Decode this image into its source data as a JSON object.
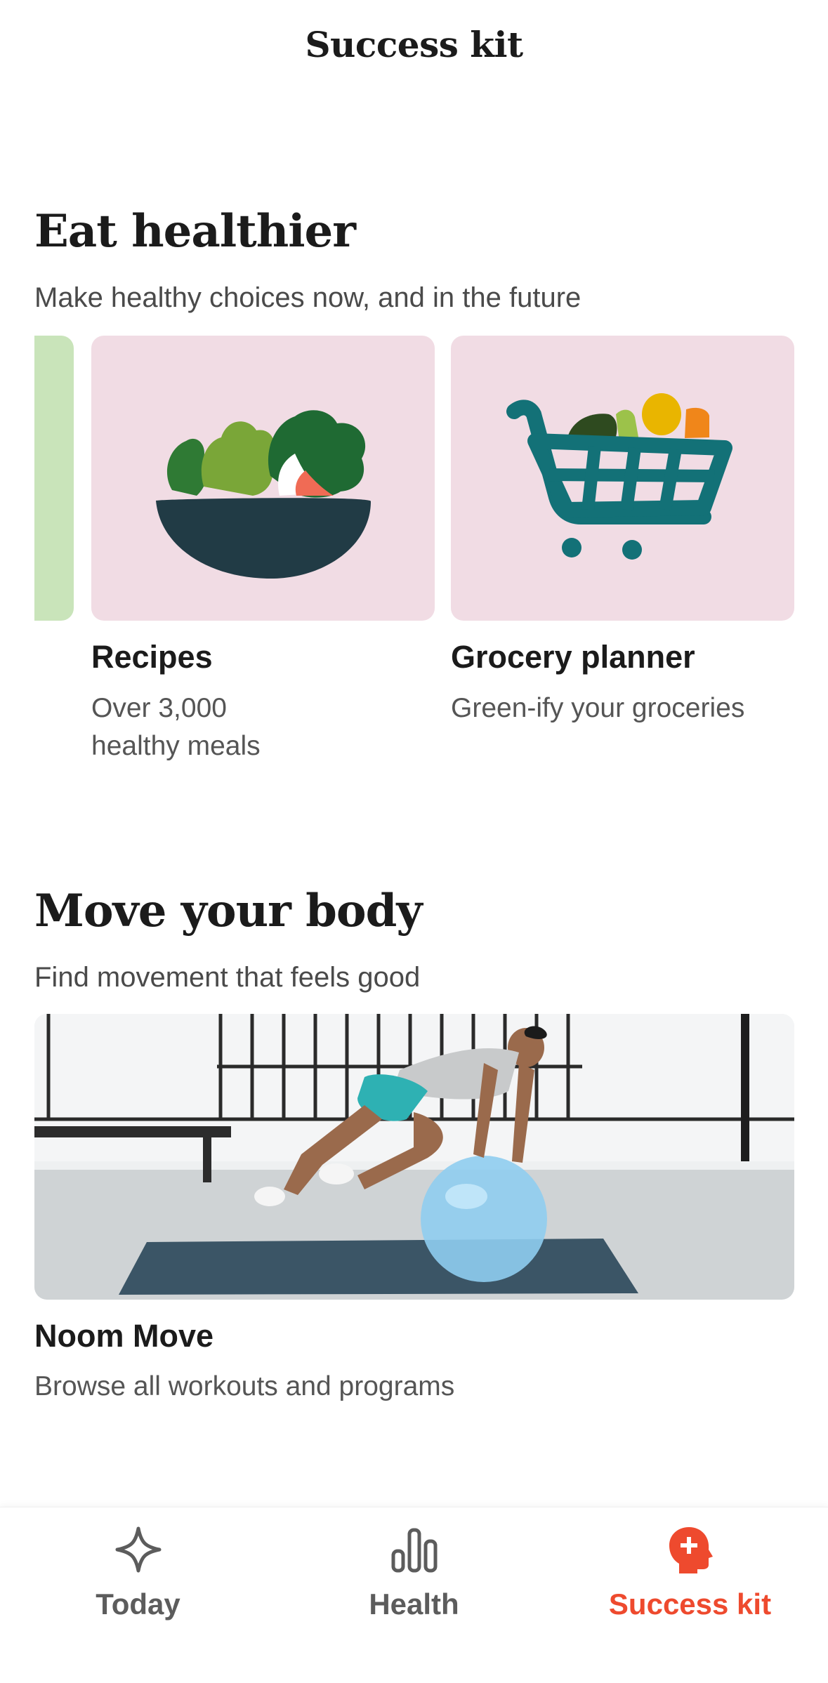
{
  "header": {
    "title": "Success kit"
  },
  "eat": {
    "title": "Eat healthier",
    "subtitle": "Make healthy choices now, and in the future",
    "cards": [
      {
        "title": "Recipes",
        "subtitle_line1": "Over 3,000",
        "subtitle_line2": "healthy meals",
        "icon": "salad-bowl-icon"
      },
      {
        "title": "Grocery planner",
        "subtitle_line1": "Green-ify your groceries",
        "icon": "shopping-cart-icon"
      }
    ]
  },
  "move": {
    "title": "Move your body",
    "subtitle": "Find movement that feels good",
    "card": {
      "title": "Noom Move",
      "subtitle": "Browse all workouts and programs"
    }
  },
  "nav": {
    "items": [
      {
        "label": "Today",
        "icon": "sparkle-icon",
        "active": false
      },
      {
        "label": "Health",
        "icon": "bar-chart-icon",
        "active": false
      },
      {
        "label": "Success kit",
        "icon": "head-plus-icon",
        "active": true
      }
    ]
  },
  "colors": {
    "accent": "#ee4a2e",
    "tile_pink": "#f1dce4",
    "tile_green": "#c9e4ba",
    "inactive_nav": "#5c5c5c"
  }
}
